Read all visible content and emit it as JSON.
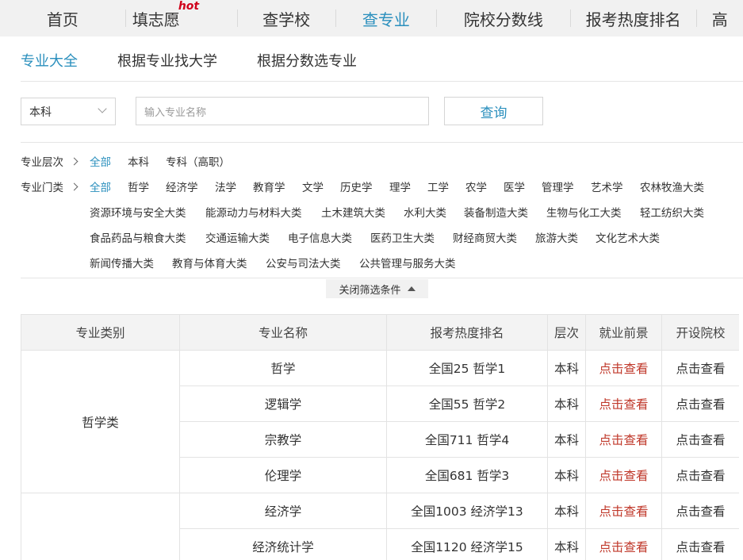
{
  "nav": {
    "items": [
      {
        "label": "首页",
        "hot": ""
      },
      {
        "label": "填志愿",
        "hot": "hot"
      },
      {
        "label": "查学校",
        "hot": ""
      },
      {
        "label": "查专业",
        "hot": ""
      },
      {
        "label": "院校分数线",
        "hot": ""
      },
      {
        "label": "报考热度排名",
        "hot": ""
      },
      {
        "label": "高",
        "hot": ""
      }
    ],
    "active_label": "查专业",
    "accent_color": "#2a8fbd",
    "hot_color": "#d0021b"
  },
  "subtabs": {
    "items": [
      "专业大全",
      "根据专业找大学",
      "根据分数选专业"
    ],
    "active": "专业大全"
  },
  "search": {
    "level_value": "本科",
    "placeholder": "输入专业名称",
    "query_label": "查询"
  },
  "filters": {
    "level": {
      "label": "专业层次",
      "options": [
        "全部",
        "本科",
        "专科（高职）"
      ],
      "active": "全部"
    },
    "category": {
      "label": "专业门类",
      "rows": [
        [
          "全部",
          "哲学",
          "经济学",
          "法学",
          "教育学",
          "文学",
          "历史学",
          "理学",
          "工学",
          "农学",
          "医学",
          "管理学",
          "艺术学",
          "农林牧渔大类"
        ],
        [
          "资源环境与安全大类",
          "能源动力与材料大类",
          "土木建筑大类",
          "水利大类",
          "装备制造大类",
          "生物与化工大类",
          "轻工纺织大类"
        ],
        [
          "食品药品与粮食大类",
          "交通运输大类",
          "电子信息大类",
          "医药卫生大类",
          "财经商贸大类",
          "旅游大类",
          "文化艺术大类"
        ],
        [
          "新闻传播大类",
          "教育与体育大类",
          "公安与司法大类",
          "公共管理与服务大类"
        ]
      ],
      "active": "全部"
    },
    "collapse_label": "关闭筛选条件"
  },
  "table": {
    "headers": [
      "专业类别",
      "专业名称",
      "报考热度排名",
      "层次",
      "就业前景",
      "开设院校"
    ],
    "groups": [
      {
        "category": "哲学类",
        "rows": [
          {
            "name": "哲学",
            "rank": "全国25 哲学1",
            "level": "本科",
            "prospect": "点击查看",
            "schools": "点击查看"
          },
          {
            "name": "逻辑学",
            "rank": "全国55 哲学2",
            "level": "本科",
            "prospect": "点击查看",
            "schools": "点击查看"
          },
          {
            "name": "宗教学",
            "rank": "全国711 哲学4",
            "level": "本科",
            "prospect": "点击查看",
            "schools": "点击查看"
          },
          {
            "name": "伦理学",
            "rank": "全国681 哲学3",
            "level": "本科",
            "prospect": "点击查看",
            "schools": "点击查看"
          }
        ]
      },
      {
        "category": "",
        "rows": [
          {
            "name": "经济学",
            "rank": "全国1003 经济学13",
            "level": "本科",
            "prospect": "点击查看",
            "schools": "点击查看"
          },
          {
            "name": "经济统计学",
            "rank": "全国1120 经济学15",
            "level": "本科",
            "prospect": "点击查看",
            "schools": "点击查看"
          }
        ]
      }
    ],
    "link_color": "#c0392b"
  }
}
